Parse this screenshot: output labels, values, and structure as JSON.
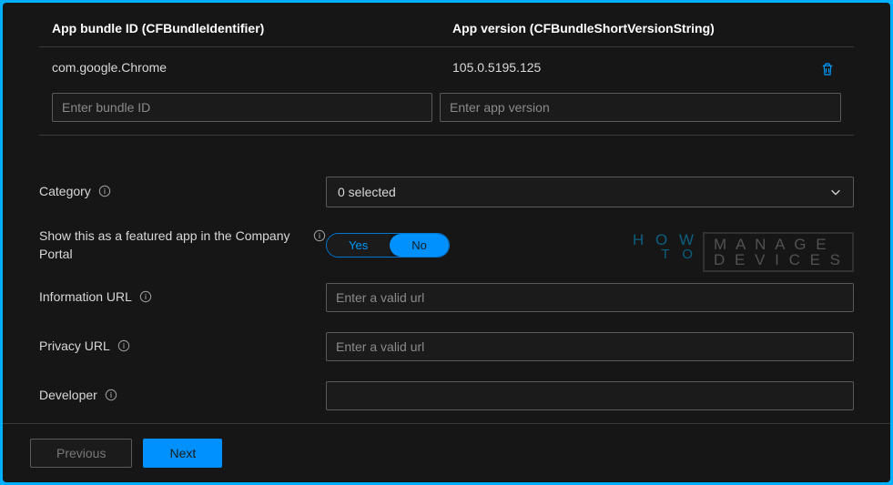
{
  "table": {
    "headers": {
      "bundle": "App bundle ID (CFBundleIdentifier)",
      "version": "App version (CFBundleShortVersionString)"
    },
    "row": {
      "bundle": "com.google.Chrome",
      "version": "105.0.5195.125"
    },
    "inputs": {
      "bundle_placeholder": "Enter bundle ID",
      "version_placeholder": "Enter app version"
    }
  },
  "form": {
    "category": {
      "label": "Category",
      "value": "0 selected"
    },
    "featured": {
      "label": "Show this as a featured app in the Company Portal",
      "yes": "Yes",
      "no": "No"
    },
    "info_url": {
      "label": "Information URL",
      "placeholder": "Enter a valid url"
    },
    "privacy_url": {
      "label": "Privacy URL",
      "placeholder": "Enter a valid url"
    },
    "developer": {
      "label": "Developer",
      "placeholder": ""
    }
  },
  "footer": {
    "previous": "Previous",
    "next": "Next"
  },
  "watermark": {
    "how": "H O W",
    "to": "T O",
    "manage": "M A N A G E",
    "devices": "D E V I C E S"
  }
}
